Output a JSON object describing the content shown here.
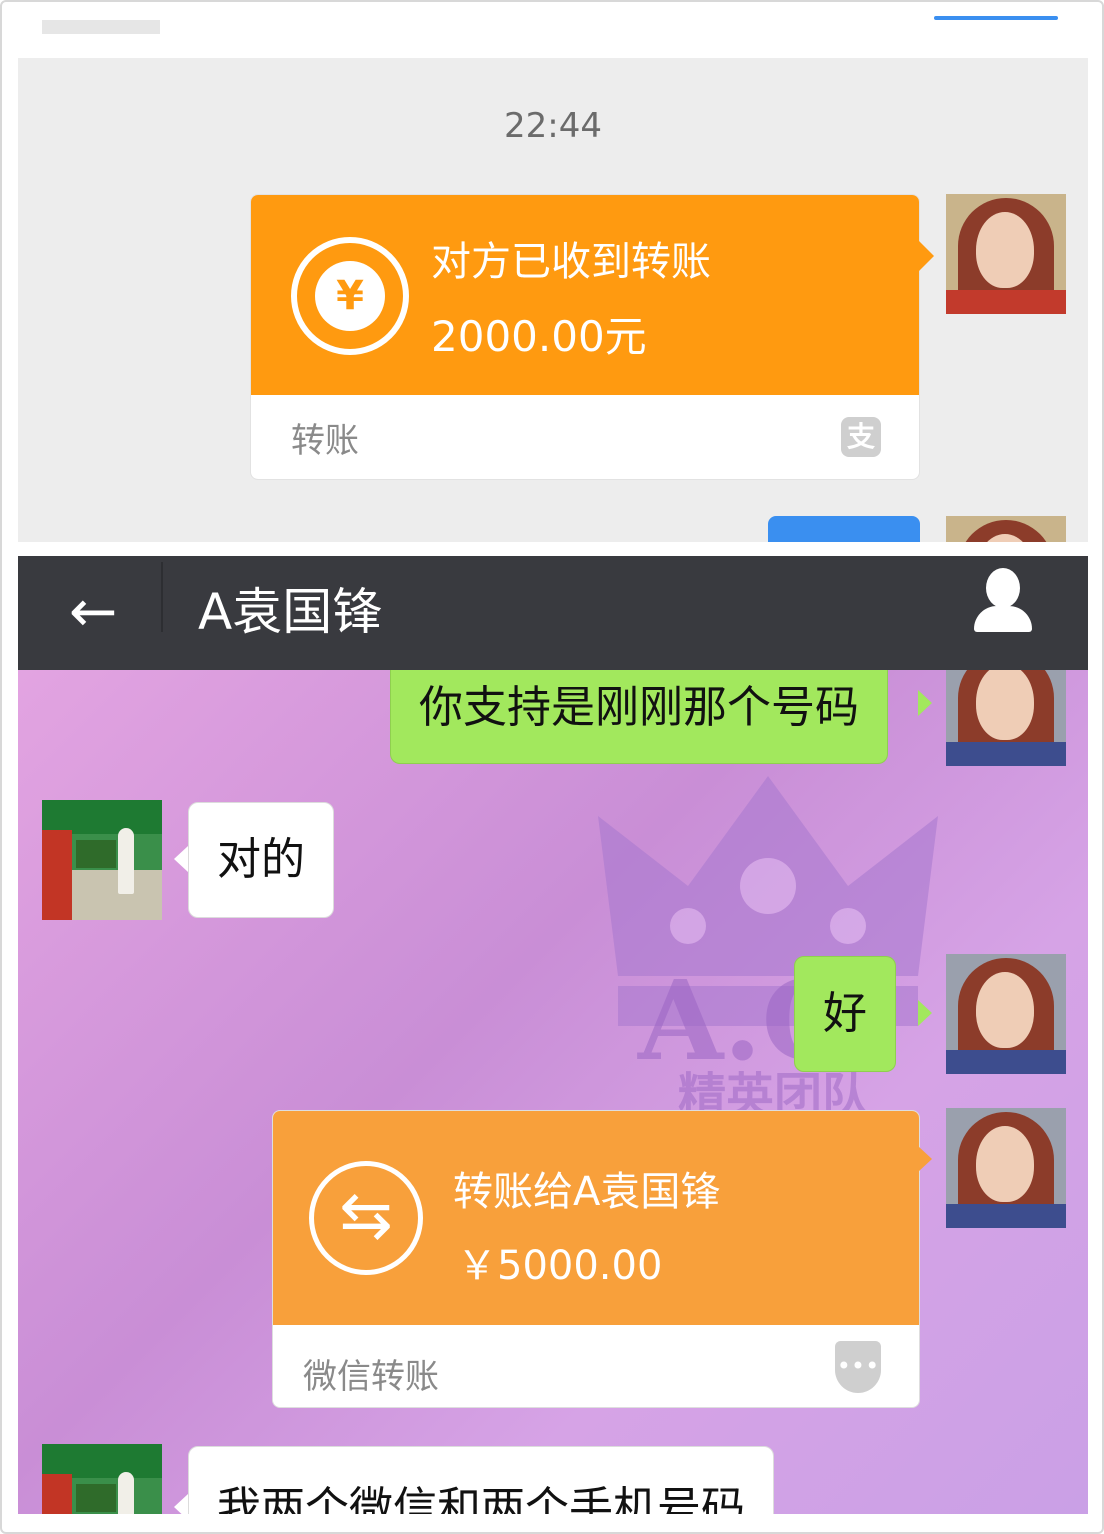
{
  "top_panel": {
    "timestamp": "22:44",
    "transfer_card": {
      "title": "对方已收到转账",
      "amount": "2000.00元",
      "footer_label": "转账",
      "coin_symbol": "¥",
      "accent_color": "#ff9a10",
      "icon": "alipay-icon"
    }
  },
  "chat_panel": {
    "header": {
      "back_symbol": "←",
      "title": "A袁国锋",
      "bg_color": "#393a3f"
    },
    "messages": [
      {
        "from": "self",
        "type": "text",
        "text": "你支持是刚刚那个号码"
      },
      {
        "from": "other",
        "type": "text",
        "text": "对的"
      },
      {
        "from": "self",
        "type": "text",
        "text": "好"
      },
      {
        "from": "self",
        "type": "transfer",
        "title": "转账给A袁国锋",
        "amount": "￥5000.00",
        "footer_label": "微信转账",
        "transfer_symbol": "⇆",
        "accent_color": "#f8a03b"
      },
      {
        "from": "other",
        "type": "text",
        "text": "我两个微信和两个手机号码"
      }
    ],
    "background_watermark": {
      "text_large": "A.C",
      "text_small": "精英团队"
    },
    "bubble_color_self": "#a2e85d",
    "bubble_color_other": "#ffffff"
  }
}
